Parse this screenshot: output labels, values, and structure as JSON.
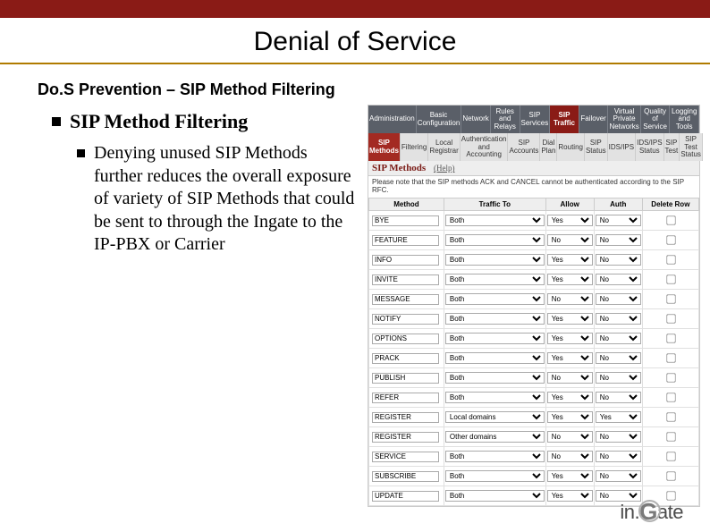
{
  "title": "Denial of Service",
  "subtitle": "Do.S Prevention – SIP Method Filtering",
  "bullet_heading": "SIP Method Filtering",
  "bullet_body": "Denying unused SIP Methods further reduces the overall exposure of variety of SIP Methods that could be sent to through the Ingate to the IP-PBX or Carrier",
  "tabs_top": [
    "Administration",
    "Basic Configuration",
    "Network",
    "Rules and Relays",
    "SIP Services",
    "SIP Traffic",
    "Failover",
    "Virtual Private Networks",
    "Quality of Service",
    "Logging and Tools"
  ],
  "tabs_top_active_index": 5,
  "tabs_sub": [
    "SIP Methods",
    "Filtering",
    "Local Registrar",
    "Authentication and Accounting",
    "SIP Accounts",
    "Dial Plan",
    "Routing",
    "SIP Status",
    "IDS/IPS",
    "IDS/IPS Status",
    "SIP Test",
    "SIP Test Status"
  ],
  "tabs_sub_active_index": 0,
  "section_header": "SIP Methods",
  "help_label": "(Help)",
  "note": "Please note that the SIP methods ACK and CANCEL cannot be authenticated according to the SIP RFC.",
  "columns": [
    "Method",
    "Traffic To",
    "Allow",
    "Auth",
    "Delete Row"
  ],
  "rows": [
    {
      "method": "BYE",
      "traffic": "Both",
      "allow": "Yes",
      "auth": "No"
    },
    {
      "method": "FEATURE",
      "traffic": "Both",
      "allow": "No",
      "auth": "No"
    },
    {
      "method": "INFO",
      "traffic": "Both",
      "allow": "Yes",
      "auth": "No"
    },
    {
      "method": "INVITE",
      "traffic": "Both",
      "allow": "Yes",
      "auth": "No"
    },
    {
      "method": "MESSAGE",
      "traffic": "Both",
      "allow": "No",
      "auth": "No"
    },
    {
      "method": "NOTIFY",
      "traffic": "Both",
      "allow": "Yes",
      "auth": "No"
    },
    {
      "method": "OPTIONS",
      "traffic": "Both",
      "allow": "Yes",
      "auth": "No"
    },
    {
      "method": "PRACK",
      "traffic": "Both",
      "allow": "Yes",
      "auth": "No"
    },
    {
      "method": "PUBLISH",
      "traffic": "Both",
      "allow": "No",
      "auth": "No"
    },
    {
      "method": "REFER",
      "traffic": "Both",
      "allow": "Yes",
      "auth": "No"
    },
    {
      "method": "REGISTER",
      "traffic": "Local domains",
      "allow": "Yes",
      "auth": "Yes"
    },
    {
      "method": "REGISTER",
      "traffic": "Other domains",
      "allow": "No",
      "auth": "No"
    },
    {
      "method": "SERVICE",
      "traffic": "Both",
      "allow": "No",
      "auth": "No"
    },
    {
      "method": "SUBSCRIBE",
      "traffic": "Both",
      "allow": "Yes",
      "auth": "No"
    },
    {
      "method": "UPDATE",
      "traffic": "Both",
      "allow": "Yes",
      "auth": "No"
    }
  ],
  "logo": {
    "part1": "in.",
    "part2": "G",
    "part3": "ate"
  }
}
